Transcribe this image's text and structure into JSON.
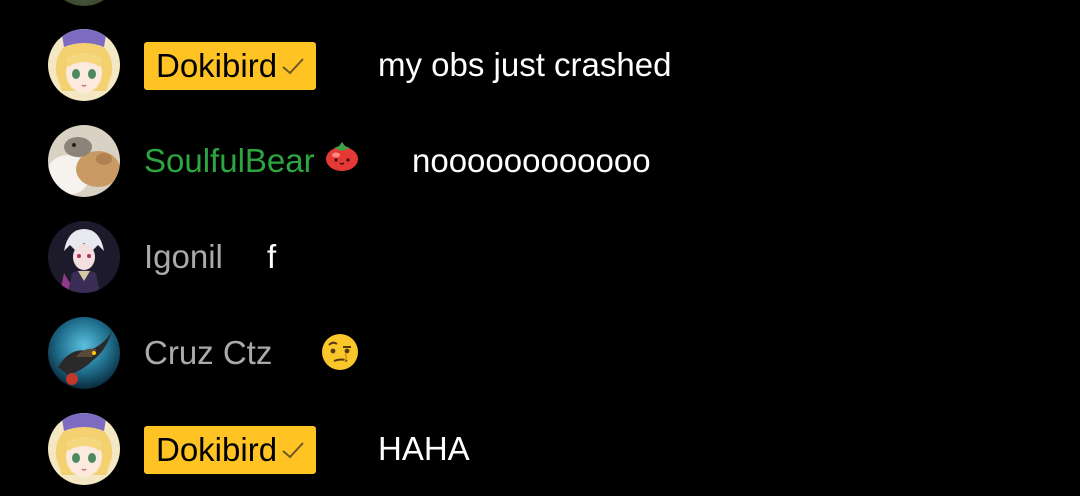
{
  "colors": {
    "background": "#000000",
    "owner_badge_bg": "#ffc324",
    "owner_text": "#000000",
    "member_name": "#2ba640",
    "plain_name": "#aaaaaa",
    "message_text": "#ffffff"
  },
  "messages": [
    {
      "author": "Dokibird",
      "author_type": "owner",
      "badge_icon": "checkmark-icon",
      "text": "my obs just crashed"
    },
    {
      "author": "SoulfulBear",
      "author_type": "member",
      "badge_icon": "tomato-membership-icon",
      "text": "noooooooooooo"
    },
    {
      "author": "Igonil",
      "author_type": "plain",
      "text": "f"
    },
    {
      "author": "Cruz Ctz",
      "author_type": "plain",
      "emoji_icon": "raised-eyebrow-emoji-icon",
      "text": ""
    },
    {
      "author": "Dokibird",
      "author_type": "owner",
      "badge_icon": "checkmark-icon",
      "text": "HAHA"
    }
  ]
}
